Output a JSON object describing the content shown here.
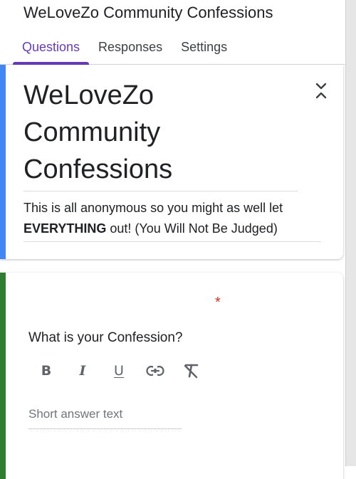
{
  "app": {
    "title": "WeLoveZo Community Confessions"
  },
  "tabs": [
    {
      "label": "Questions",
      "active": true
    },
    {
      "label": "Responses",
      "active": false
    },
    {
      "label": "Settings",
      "active": false
    }
  ],
  "form": {
    "title_lines": [
      "WeLoveZo",
      "Community",
      "Confessions"
    ],
    "description": {
      "line1": "This is all anonymous so you might as well let",
      "bold": "EVERYTHING",
      "rest": " out! (You Will Not Be Judged)"
    },
    "accent_color": "#4285f4"
  },
  "question": {
    "required_marker": "*",
    "text": "What is your Confession?",
    "answer_placeholder": "Short answer text",
    "accent_color": "#2e7d32",
    "format_tools": {
      "bold": "B",
      "italic": "I",
      "underline": "U"
    }
  },
  "theme": {
    "accent": "#673ab7",
    "required": "#d93025"
  }
}
